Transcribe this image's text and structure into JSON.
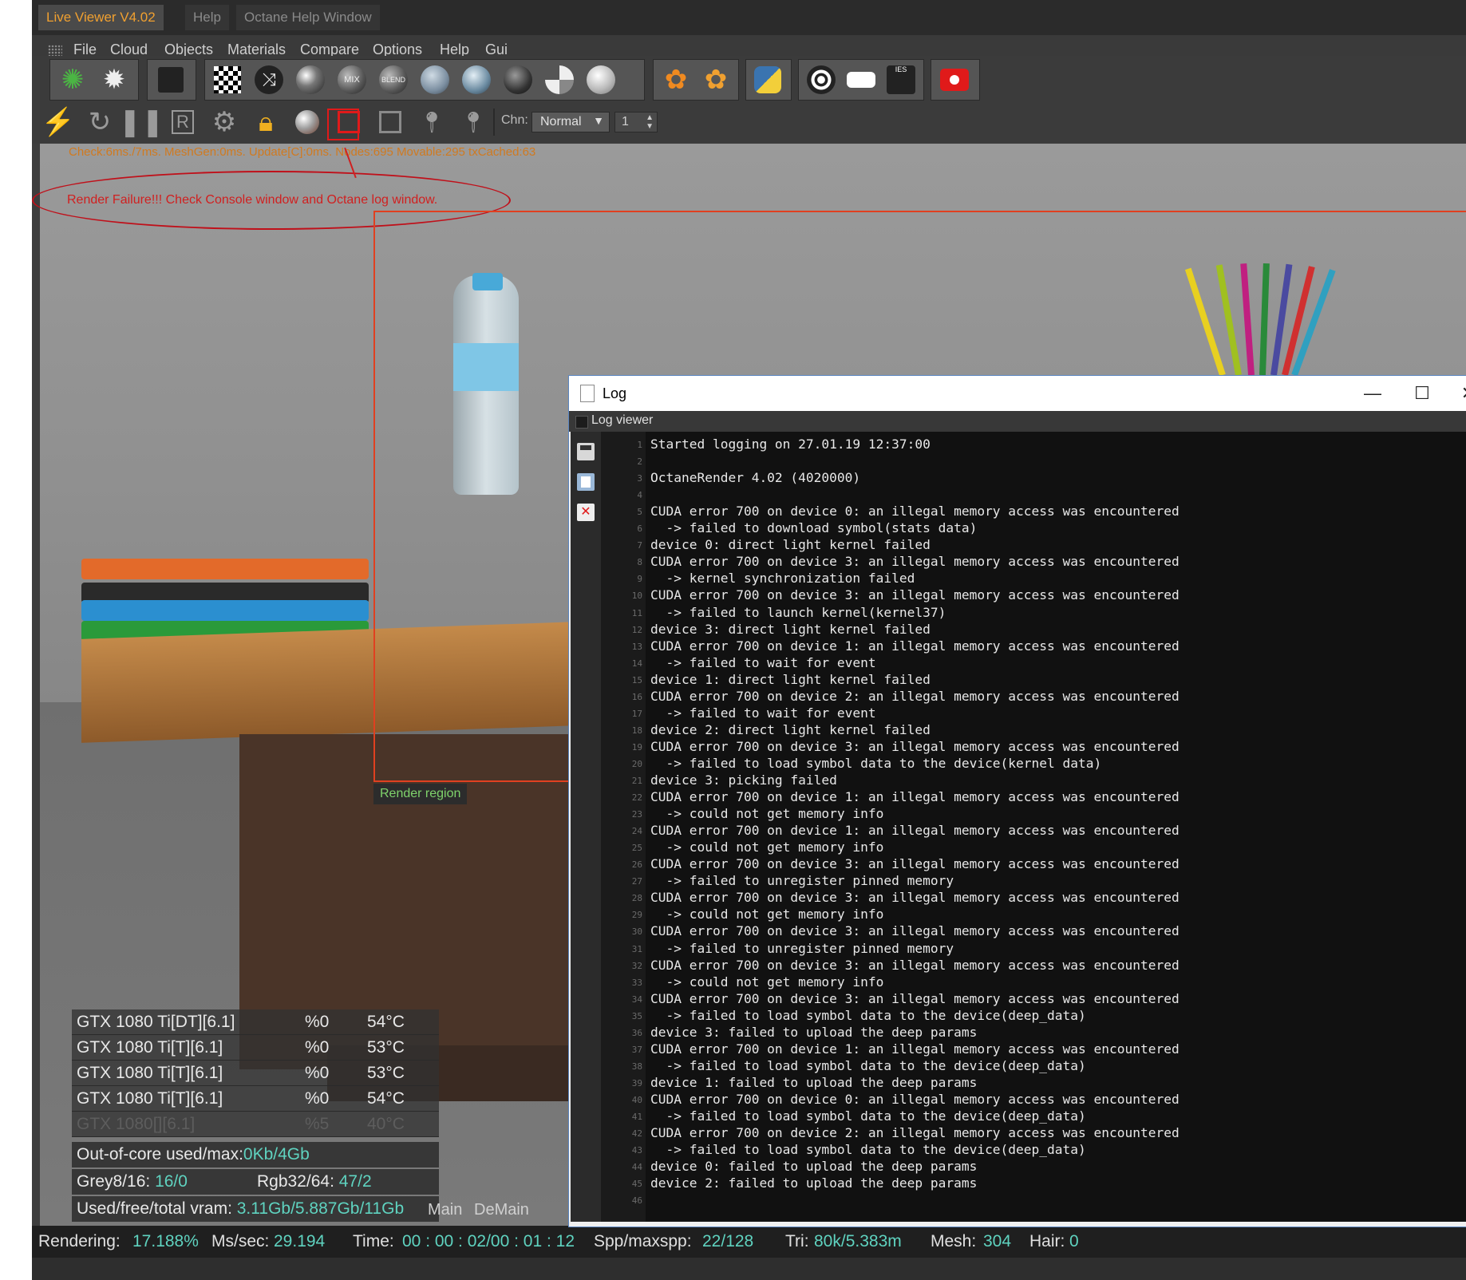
{
  "tabs": [
    "Live Viewer V4.02",
    "Help",
    "Octane Help Window"
  ],
  "menu": [
    "File",
    "Cloud",
    "Objects",
    "Materials",
    "Compare",
    "Options",
    "Help",
    "Gui"
  ],
  "toolbar1": {
    "mix_label": "MIX",
    "blend_label": "BLEND",
    "ies_label": "IES"
  },
  "toolbar2": {
    "chn_label": "Chn:",
    "channel_value": "Normal",
    "spin_value": "1"
  },
  "status_line": "Check:6ms./7ms. MeshGen:0ms. Update[C]:0ms. Nodes:695 Movable:295 txCached:63",
  "render_failure": "Render Failure!!! Check Console window and Octane log window.",
  "render_region_label": "Render region",
  "gpus": [
    {
      "name": "GTX 1080 Ti[DT][6.1]",
      "load": "%0",
      "temp": "54°C"
    },
    {
      "name": "GTX 1080 Ti[T][6.1]",
      "load": "%0",
      "temp": "53°C"
    },
    {
      "name": "GTX 1080 Ti[T][6.1]",
      "load": "%0",
      "temp": "53°C"
    },
    {
      "name": "GTX 1080 Ti[T][6.1]",
      "load": "%0",
      "temp": "54°C"
    },
    {
      "name": "GTX 1080[][6.1]",
      "load": "%5",
      "temp": "40°C"
    }
  ],
  "memory": {
    "ooc_label": "Out-of-core used/max:",
    "ooc_value": "0Kb/4Gb",
    "grey_label": "Grey8/16: ",
    "grey_value": "16/0",
    "rgb_label": "Rgb32/64: ",
    "rgb_value": "47/2",
    "vram_label": "Used/free/total vram: ",
    "vram_value": "3.11Gb/5.887Gb/11Gb"
  },
  "viewport_tabs": [
    "Main",
    "DeMain"
  ],
  "statusbar": {
    "rendering_label": "Rendering:",
    "rendering_value": "17.188%",
    "mssec_label": "Ms/sec:",
    "mssec_value": "29.194",
    "time_label": "Time:",
    "time_value": "00 : 00 : 02/00 : 01 : 12",
    "spp_label": "Spp/maxspp:",
    "spp_value": "22/128",
    "tri_label": "Tri:",
    "tri_value": "80k/5.383m",
    "mesh_label": "Mesh:",
    "mesh_value": "304",
    "hair_label": "Hair:",
    "hair_value": "0"
  },
  "log": {
    "title": "Log",
    "subtitle": "Log viewer",
    "lines": [
      "Started logging on 27.01.19 12:37:00",
      "",
      "OctaneRender 4.02 (4020000)",
      "",
      "CUDA error 700 on device 0: an illegal memory access was encountered",
      "  -> failed to download symbol(stats data)",
      "device 0: direct light kernel failed",
      "CUDA error 700 on device 3: an illegal memory access was encountered",
      "  -> kernel synchronization failed",
      "CUDA error 700 on device 3: an illegal memory access was encountered",
      "  -> failed to launch kernel(kernel37)",
      "device 3: direct light kernel failed",
      "CUDA error 700 on device 1: an illegal memory access was encountered",
      "  -> failed to wait for event",
      "device 1: direct light kernel failed",
      "CUDA error 700 on device 2: an illegal memory access was encountered",
      "  -> failed to wait for event",
      "device 2: direct light kernel failed",
      "CUDA error 700 on device 3: an illegal memory access was encountered",
      "  -> failed to load symbol data to the device(kernel data)",
      "device 3: picking failed",
      "CUDA error 700 on device 1: an illegal memory access was encountered",
      "  -> could not get memory info",
      "CUDA error 700 on device 1: an illegal memory access was encountered",
      "  -> could not get memory info",
      "CUDA error 700 on device 3: an illegal memory access was encountered",
      "  -> failed to unregister pinned memory",
      "CUDA error 700 on device 3: an illegal memory access was encountered",
      "  -> could not get memory info",
      "CUDA error 700 on device 3: an illegal memory access was encountered",
      "  -> failed to unregister pinned memory",
      "CUDA error 700 on device 3: an illegal memory access was encountered",
      "  -> could not get memory info",
      "CUDA error 700 on device 3: an illegal memory access was encountered",
      "  -> failed to load symbol data to the device(deep_data)",
      "device 3: failed to upload the deep params",
      "CUDA error 700 on device 1: an illegal memory access was encountered",
      "  -> failed to load symbol data to the device(deep_data)",
      "device 1: failed to upload the deep params",
      "CUDA error 700 on device 0: an illegal memory access was encountered",
      "  -> failed to load symbol data to the device(deep_data)",
      "CUDA error 700 on device 2: an illegal memory access was encountered",
      "  -> failed to load symbol data to the device(deep_data)",
      "device 0: failed to upload the deep params",
      "device 2: failed to upload the deep params",
      ""
    ]
  },
  "colors": {
    "accent_orange": "#f0a030",
    "error_red": "#d02020",
    "value_cyan": "#5fd3c0",
    "region_border": "#e04020"
  }
}
